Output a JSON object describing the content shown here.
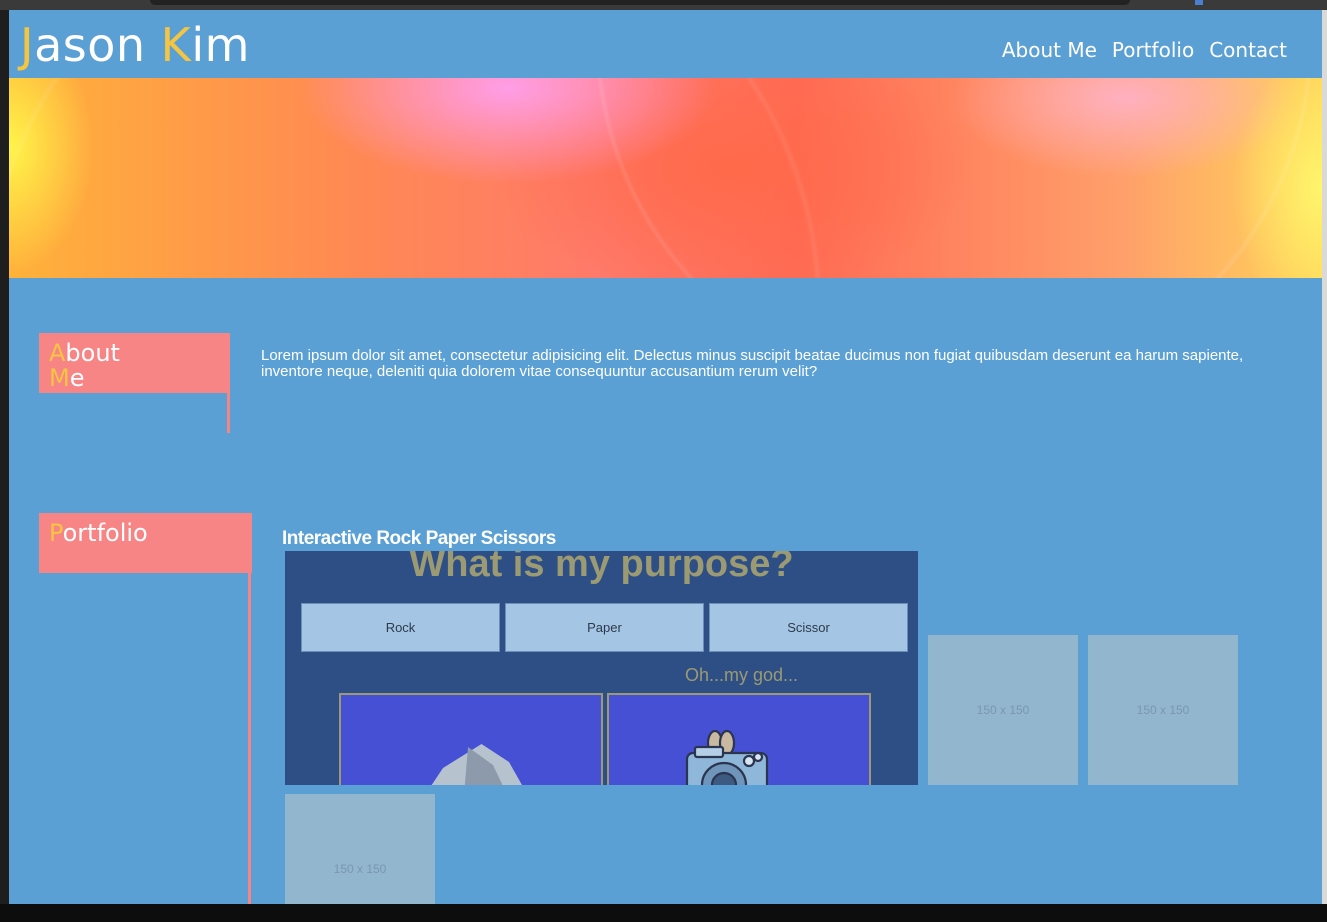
{
  "header": {
    "title_first_initial": "J",
    "title_first_rest": "ason ",
    "title_last_initial": "K",
    "title_last_rest": "im",
    "nav": [
      {
        "label": "About Me"
      },
      {
        "label": "Portfolio"
      },
      {
        "label": "Contact"
      }
    ]
  },
  "about": {
    "label_line1_initial": "A",
    "label_line1_rest": "bout",
    "label_line2_initial": "M",
    "label_line2_rest": "e",
    "text": "Lorem ipsum dolor sit amet, consectetur adipisicing elit. Delectus minus suscipit beatae ducimus non fugiat quibusdam deserunt ea harum sapiente, inventore neque, deleniti quia dolorem vitae consequuntur accusantium rerum velit?"
  },
  "portfolio": {
    "label_initial": "P",
    "label_rest": "ortfolio",
    "project_title": "Interactive Rock Paper Scissors",
    "game": {
      "heading": "What is my purpose?",
      "buttons": [
        "Rock",
        "Paper",
        "Scissor"
      ],
      "status": "Oh...my god..."
    },
    "placeholders": [
      "150 x 150",
      "150 x 150",
      "150 x 150"
    ]
  },
  "colors": {
    "background": "#5ba0d4",
    "accent": "#f5c542",
    "label_bg": "#f78585",
    "game_bg": "#2d4f85"
  }
}
